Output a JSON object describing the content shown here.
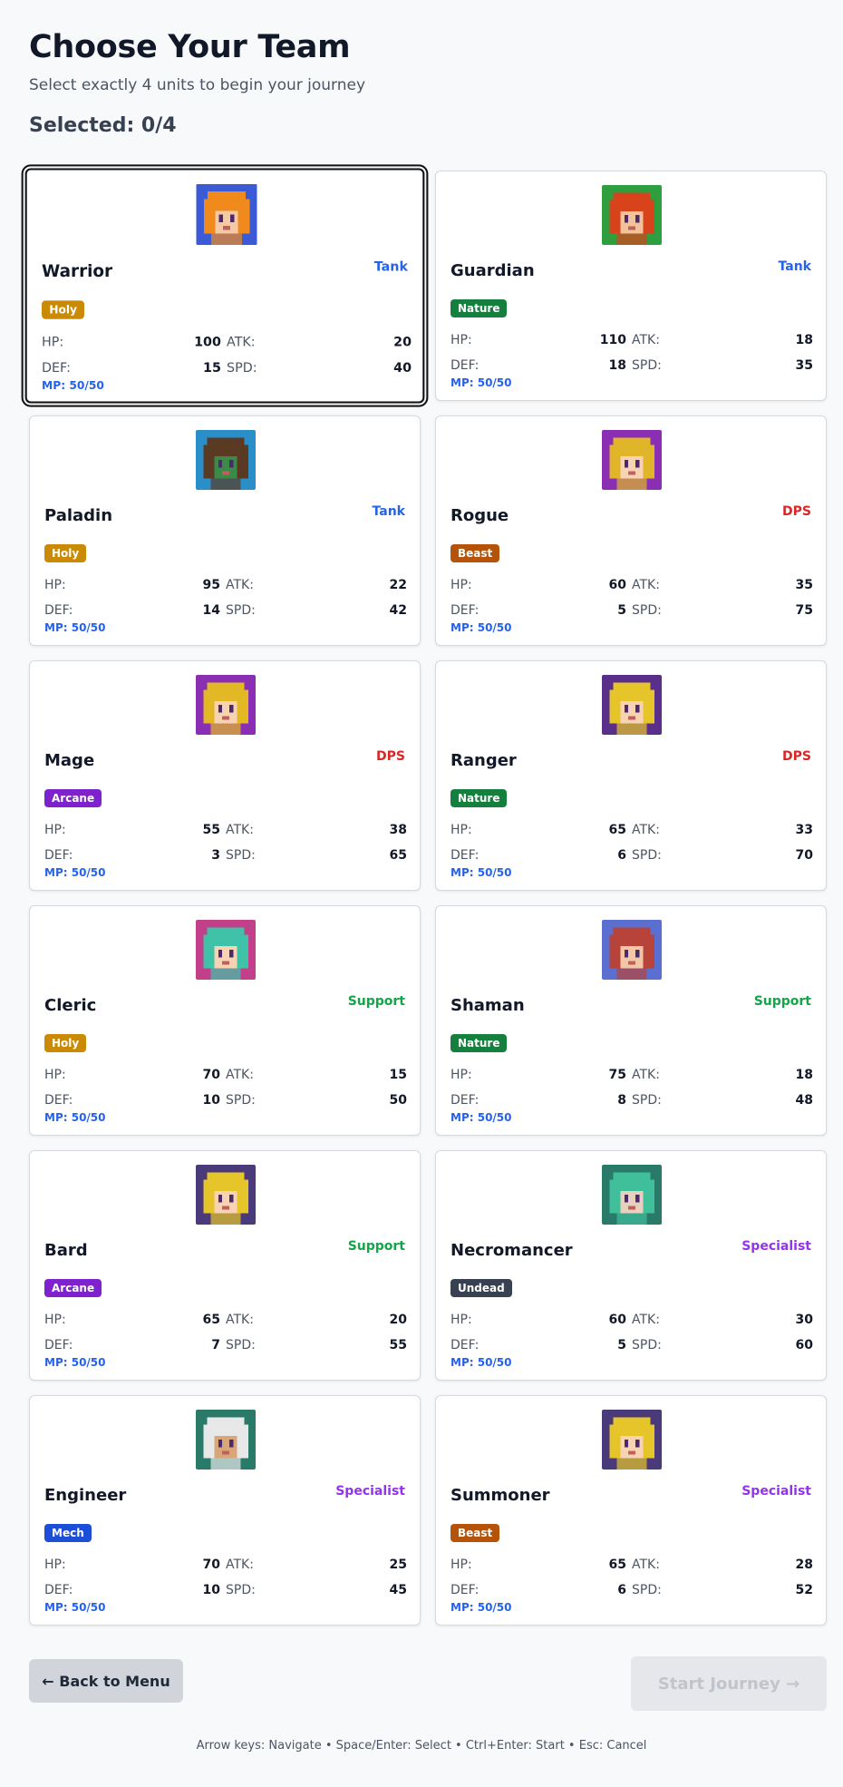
{
  "header": {
    "title": "Choose Your Team",
    "subtitle": "Select exactly 4 units to begin your journey",
    "selected_label": "Selected: 0/4"
  },
  "labels": {
    "hp": "HP:",
    "atk": "ATK:",
    "def": "DEF:",
    "spd": "SPD:"
  },
  "colors": {
    "role": {
      "Tank": "#2563eb",
      "DPS": "#dc2626",
      "Support": "#16a34a",
      "Specialist": "#9333ea"
    },
    "element": {
      "Holy": "#ca8a04",
      "Nature": "#15803d",
      "Beast": "#b45309",
      "Arcane": "#7e22ce",
      "Undead": "#374151",
      "Mech": "#1d4ed8"
    }
  },
  "units": [
    {
      "name": "Warrior",
      "role": "Tank",
      "element": "Holy",
      "hp": "100",
      "atk": "20",
      "def": "15",
      "spd": "40",
      "mp": "MP: 50/50",
      "portrait": "warrior-portrait",
      "bg": "#3b5bd6",
      "hair": "#f08a1c",
      "skin": "#f5c9a3",
      "focused": true
    },
    {
      "name": "Guardian",
      "role": "Tank",
      "element": "Nature",
      "hp": "110",
      "atk": "18",
      "def": "18",
      "spd": "35",
      "mp": "MP: 50/50",
      "portrait": "guardian-portrait",
      "bg": "#2f9e3f",
      "hair": "#d8431c",
      "skin": "#f2c29a"
    },
    {
      "name": "Paladin",
      "role": "Tank",
      "element": "Holy",
      "hp": "95",
      "atk": "22",
      "def": "14",
      "spd": "42",
      "mp": "MP: 50/50",
      "portrait": "paladin-portrait",
      "bg": "#2a8fc9",
      "hair": "#5a3a22",
      "skin": "#3c8a4a"
    },
    {
      "name": "Rogue",
      "role": "DPS",
      "element": "Beast",
      "hp": "60",
      "atk": "35",
      "def": "5",
      "spd": "75",
      "mp": "MP: 50/50",
      "portrait": "rogue-portrait",
      "bg": "#8a2fb4",
      "hair": "#e0b52a",
      "skin": "#f7d3b4"
    },
    {
      "name": "Mage",
      "role": "DPS",
      "element": "Arcane",
      "hp": "55",
      "atk": "38",
      "def": "3",
      "spd": "65",
      "mp": "MP: 50/50",
      "portrait": "mage-portrait",
      "bg": "#8a2fb4",
      "hair": "#e3b825",
      "skin": "#f7d3b4"
    },
    {
      "name": "Ranger",
      "role": "DPS",
      "element": "Nature",
      "hp": "65",
      "atk": "33",
      "def": "6",
      "spd": "70",
      "mp": "MP: 50/50",
      "portrait": "ranger-portrait",
      "bg": "#5a2f8a",
      "hair": "#e6c52a",
      "skin": "#f7d3b4"
    },
    {
      "name": "Cleric",
      "role": "Support",
      "element": "Holy",
      "hp": "70",
      "atk": "15",
      "def": "10",
      "spd": "50",
      "mp": "MP: 50/50",
      "portrait": "cleric-portrait",
      "bg": "#c2408a",
      "hair": "#3fc2a8",
      "skin": "#f7d3b4"
    },
    {
      "name": "Shaman",
      "role": "Support",
      "element": "Nature",
      "hp": "75",
      "atk": "18",
      "def": "8",
      "spd": "48",
      "mp": "MP: 50/50",
      "portrait": "shaman-portrait",
      "bg": "#5a6fd0",
      "hair": "#b8433a",
      "skin": "#f2c7a8"
    },
    {
      "name": "Bard",
      "role": "Support",
      "element": "Arcane",
      "hp": "65",
      "atk": "20",
      "def": "7",
      "spd": "55",
      "mp": "MP: 50/50",
      "portrait": "bard-portrait",
      "bg": "#4a3a7a",
      "hair": "#e6c52a",
      "skin": "#f7d3b4"
    },
    {
      "name": "Necromancer",
      "role": "Specialist",
      "element": "Undead",
      "hp": "60",
      "atk": "30",
      "def": "5",
      "spd": "60",
      "mp": "MP: 50/50",
      "portrait": "necromancer-portrait",
      "bg": "#2a7a6a",
      "hair": "#3fbf9a",
      "skin": "#e8d0c0"
    },
    {
      "name": "Engineer",
      "role": "Specialist",
      "element": "Mech",
      "hp": "70",
      "atk": "25",
      "def": "10",
      "spd": "45",
      "mp": "MP: 50/50",
      "portrait": "engineer-portrait",
      "bg": "#2a7a6a",
      "hair": "#e8e8e8",
      "skin": "#d9a67a"
    },
    {
      "name": "Summoner",
      "role": "Specialist",
      "element": "Beast",
      "hp": "65",
      "atk": "28",
      "def": "6",
      "spd": "52",
      "mp": "MP: 50/50",
      "portrait": "summoner-portrait",
      "bg": "#4a3a7a",
      "hair": "#e6c52a",
      "skin": "#f7d3b4"
    }
  ],
  "footer": {
    "back_label": "← Back to Menu",
    "start_label": "Start Journey →",
    "hint": "Arrow keys: Navigate • Space/Enter: Select • Ctrl+Enter: Start • Esc: Cancel"
  }
}
